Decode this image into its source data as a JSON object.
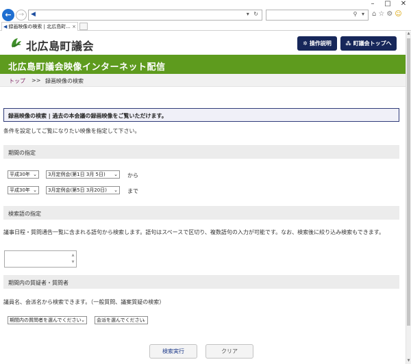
{
  "browser": {
    "address_value": "",
    "search_value": "",
    "tab_title": "録画映像の検索 | 北広島町...",
    "tab_close": "×"
  },
  "header": {
    "logo_text": "北広島町議会",
    "help_label": "操作説明",
    "top_label": "町議会トップへ"
  },
  "banner": {
    "title": "北広島町議会映像インターネット配信"
  },
  "breadcrumb": {
    "home": "トップ",
    "sep": ">>",
    "current": "録画映像の検索"
  },
  "intro": {
    "box_text": "録画映像の検索 | 過去の本会議の録画映像をご覧いただけます。",
    "instruction": "条件を設定してご覧になりたい映像を指定して下さい。"
  },
  "period": {
    "heading": "期間の指定",
    "from": {
      "era_year": "平成30年",
      "session": "3月定例会(第1日 3月 5日)",
      "word": "から"
    },
    "to": {
      "era_year": "平成30年",
      "session": "3月定例会(第5日 3月20日)",
      "word": "まで"
    }
  },
  "keyword": {
    "heading": "検索語の指定",
    "description": "議事日程・質問通告一覧に含まれる語句から検索します。語句はスペースで区切り、複数語句の入力が可能です。なお、検索後に絞り込み検索もできます。",
    "value": ""
  },
  "person": {
    "heading": "期間内の質疑者・質問者",
    "description": "議員名、会派名から検索できます。（一般質問、議案質疑の検索）",
    "member_select": "期間内の質問者を選んでください",
    "faction_select": "会派を選んでください"
  },
  "actions": {
    "search": "検索実行",
    "clear": "クリア"
  }
}
